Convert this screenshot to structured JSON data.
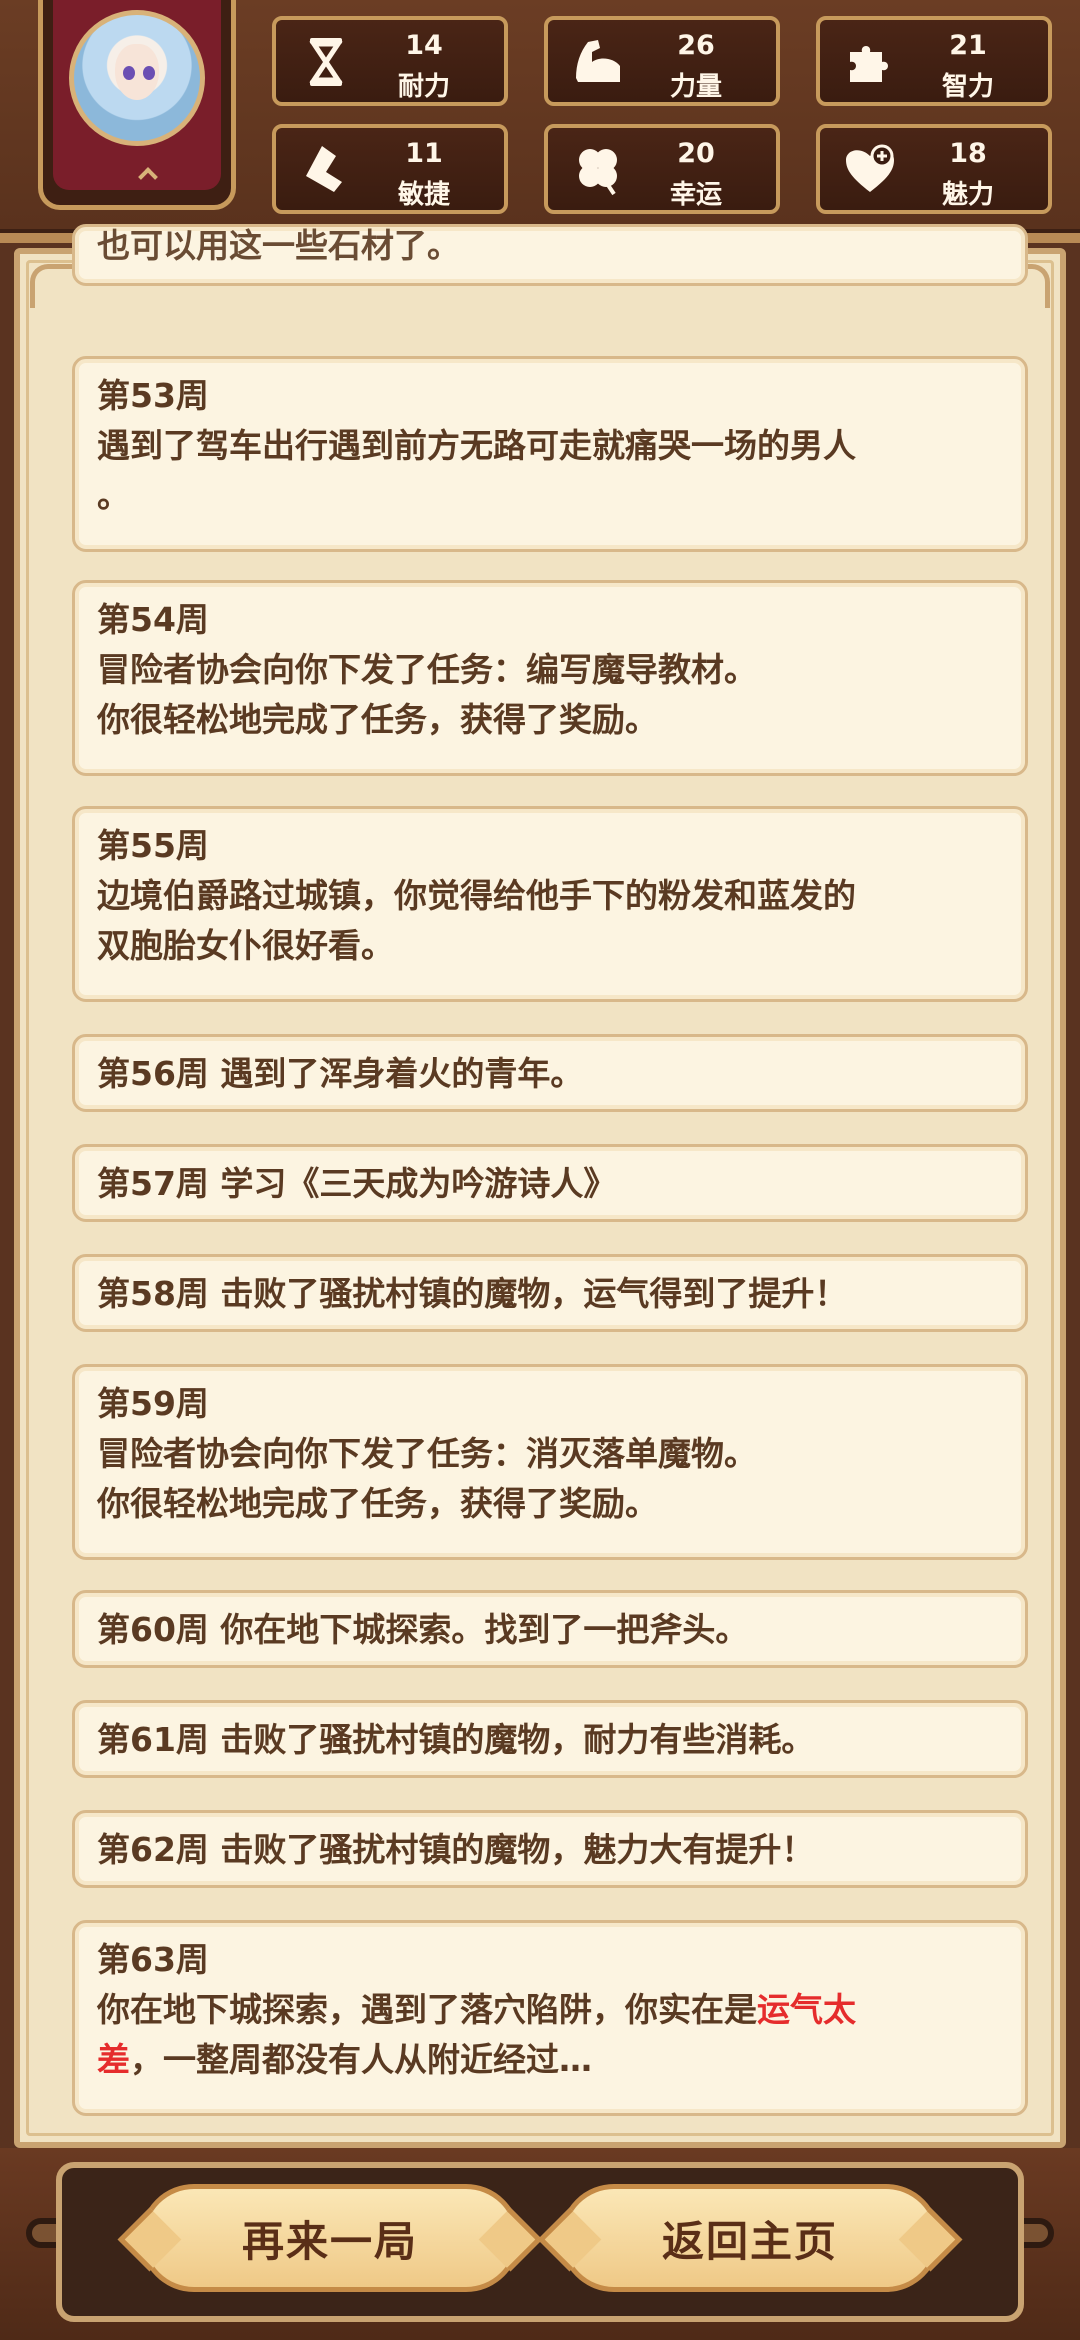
{
  "stats": [
    {
      "value": "14",
      "label": "耐力",
      "icon": "hourglass-icon"
    },
    {
      "value": "26",
      "label": "力量",
      "icon": "muscle-arm-icon"
    },
    {
      "value": "21",
      "label": "智力",
      "icon": "puzzle-piece-icon"
    },
    {
      "value": "11",
      "label": "敏捷",
      "icon": "boot-icon"
    },
    {
      "value": "20",
      "label": "幸运",
      "icon": "clover-icon"
    },
    {
      "value": "18",
      "label": "魅力",
      "icon": "heart-plus-icon"
    }
  ],
  "log": {
    "partial_top": "也可以用这一些石材了。",
    "entries": [
      {
        "week": "第53周",
        "lines": [
          "遇到了驾车出行遇到前方无路可走就痛哭一场的男人",
          "。"
        ]
      },
      {
        "week": "第54周",
        "lines": [
          "冒险者协会向你下发了任务：编写魔导教材。",
          "你很轻松地完成了任务，获得了奖励。"
        ]
      },
      {
        "week": "第55周",
        "lines": [
          "边境伯爵路过城镇，你觉得给他手下的粉发和蓝发的",
          "双胞胎女仆很好看。"
        ]
      },
      {
        "week": "第56周",
        "text": "遇到了浑身着火的青年。"
      },
      {
        "week": "第57周",
        "text": "学习《三天成为吟游诗人》"
      },
      {
        "week": "第58周",
        "text": "击败了骚扰村镇的魔物，运气得到了提升！"
      },
      {
        "week": "第59周",
        "lines": [
          "冒险者协会向你下发了任务：消灭落单魔物。",
          "你很轻松地完成了任务，获得了奖励。"
        ]
      },
      {
        "week": "第60周",
        "text": "你在地下城探索。找到了一把斧头。"
      },
      {
        "week": "第61周",
        "text": "击败了骚扰村镇的魔物，耐力有些消耗。"
      },
      {
        "week": "第62周",
        "text": "击败了骚扰村镇的魔物，魅力大有提升！"
      },
      {
        "week": "第63周",
        "line1_pre": "你在地下城探索，遇到了落穴陷阱，你实在是",
        "line1_red": "运气太",
        "line2_red": "差",
        "line2_post": "，一整周都没有人从附近经过…"
      }
    ]
  },
  "buttons": {
    "replay": "再来一局",
    "home": "返回主页"
  },
  "colors": {
    "highlight": "#e52c2c",
    "text": "#5a3a22"
  }
}
